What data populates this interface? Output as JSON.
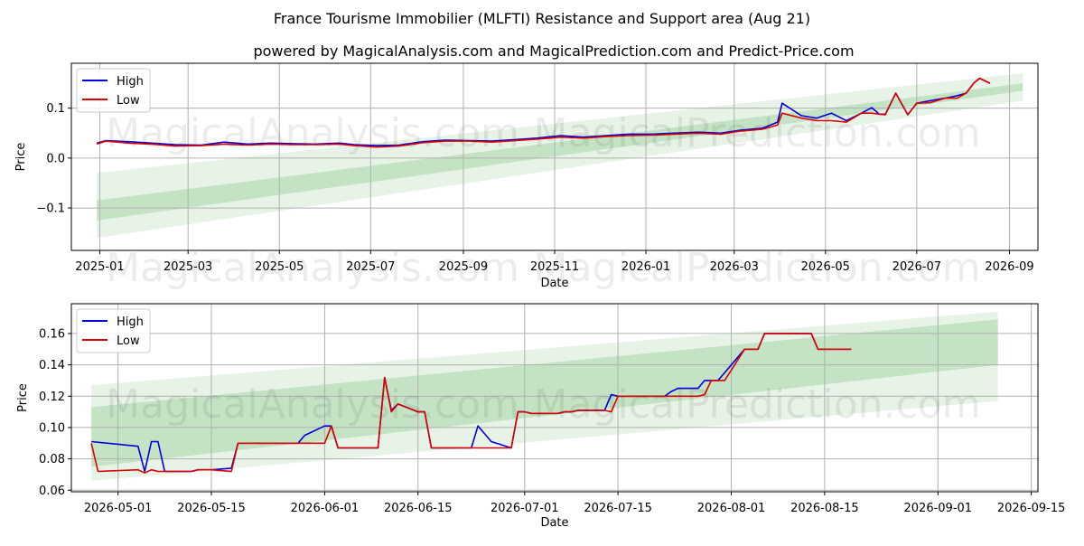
{
  "title": "France Tourisme Immobilier (MLFTI) Resistance and Support area (Aug 21)",
  "subtitle": "powered by MagicalAnalysis.com and MagicalPrediction.com and Predict-Price.com",
  "watermarks": [
    "MagicalAnalysis.com",
    "MagicalPrediction.com"
  ],
  "colors": {
    "high": "#0000dd",
    "low": "#dd0000",
    "band": "#2e9a2e",
    "grid": "#b0b0b0"
  },
  "chart_data": [
    {
      "type": "line",
      "xlabel": "Date",
      "ylabel": "Price",
      "xlim": [
        "2024-12-13",
        "2026-09-20"
      ],
      "ylim": [
        -0.185,
        0.19
      ],
      "xticks": [
        "2025-01-01",
        "2025-03-01",
        "2025-05-01",
        "2025-07-01",
        "2025-09-01",
        "2025-11-01",
        "2026-01-01",
        "2026-03-01",
        "2026-05-01",
        "2026-07-01",
        "2026-09-01"
      ],
      "xtick_labels": [
        "2025-01",
        "2025-03",
        "2025-05",
        "2025-07",
        "2025-09",
        "2025-11",
        "2026-01",
        "2026-03",
        "2026-05",
        "2026-07",
        "2026-09"
      ],
      "yticks": [
        -0.1,
        0.0,
        0.1
      ],
      "ytick_labels": [
        "−0.1",
        "0.0",
        "0.1"
      ],
      "grid": true,
      "legend": "top-left",
      "bands": [
        {
          "x": [
            "2024-12-30",
            "2026-09-10"
          ],
          "lower": [
            -0.16,
            0.115
          ],
          "upper": [
            -0.03,
            0.17
          ],
          "opacity": 0.12
        },
        {
          "x": [
            "2024-12-30",
            "2026-09-10"
          ],
          "lower": [
            -0.125,
            0.135
          ],
          "upper": [
            -0.085,
            0.15
          ],
          "opacity": 0.18
        }
      ],
      "series": [
        {
          "name": "High",
          "x": [
            "2024-12-30",
            "2025-01-05",
            "2025-01-20",
            "2025-02-05",
            "2025-02-20",
            "2025-03-10",
            "2025-03-25",
            "2025-04-10",
            "2025-04-25",
            "2025-05-10",
            "2025-05-25",
            "2025-06-10",
            "2025-06-20",
            "2025-07-05",
            "2025-07-20",
            "2025-08-05",
            "2025-08-20",
            "2025-09-05",
            "2025-09-20",
            "2025-10-05",
            "2025-10-20",
            "2025-11-05",
            "2025-11-20",
            "2025-12-05",
            "2025-12-20",
            "2026-01-05",
            "2026-01-20",
            "2026-02-05",
            "2026-02-20",
            "2026-03-05",
            "2026-03-20",
            "2026-03-30",
            "2026-04-02",
            "2026-04-15",
            "2026-04-25",
            "2026-05-05",
            "2026-05-15",
            "2026-05-25",
            "2026-06-01",
            "2026-06-06",
            "2026-06-10",
            "2026-06-17",
            "2026-06-25",
            "2026-07-01",
            "2026-07-10",
            "2026-07-20",
            "2026-07-28",
            "2026-08-03",
            "2026-08-08",
            "2026-08-12",
            "2026-08-19"
          ],
          "values": [
            0.03,
            0.035,
            0.033,
            0.03,
            0.027,
            0.026,
            0.032,
            0.028,
            0.03,
            0.029,
            0.028,
            0.03,
            0.027,
            0.025,
            0.026,
            0.033,
            0.036,
            0.035,
            0.034,
            0.037,
            0.04,
            0.045,
            0.042,
            0.045,
            0.048,
            0.048,
            0.05,
            0.052,
            0.05,
            0.056,
            0.06,
            0.072,
            0.11,
            0.085,
            0.08,
            0.09,
            0.075,
            0.09,
            0.101,
            0.088,
            0.088,
            0.13,
            0.087,
            0.11,
            0.115,
            0.12,
            0.125,
            0.13,
            0.15,
            0.16,
            0.15
          ]
        },
        {
          "name": "Low",
          "x": [
            "2024-12-30",
            "2025-01-05",
            "2025-01-20",
            "2025-02-05",
            "2025-02-20",
            "2025-03-10",
            "2025-03-25",
            "2025-04-10",
            "2025-04-25",
            "2025-05-10",
            "2025-05-25",
            "2025-06-10",
            "2025-06-20",
            "2025-07-05",
            "2025-07-20",
            "2025-08-05",
            "2025-08-20",
            "2025-09-05",
            "2025-09-20",
            "2025-10-05",
            "2025-10-20",
            "2025-11-05",
            "2025-11-20",
            "2025-12-05",
            "2025-12-20",
            "2026-01-05",
            "2026-01-20",
            "2026-02-05",
            "2026-02-20",
            "2026-03-05",
            "2026-03-20",
            "2026-03-30",
            "2026-04-02",
            "2026-04-15",
            "2026-04-25",
            "2026-05-05",
            "2026-05-15",
            "2026-05-25",
            "2026-06-01",
            "2026-06-06",
            "2026-06-10",
            "2026-06-17",
            "2026-06-25",
            "2026-07-01",
            "2026-07-10",
            "2026-07-20",
            "2026-07-28",
            "2026-08-03",
            "2026-08-08",
            "2026-08-12",
            "2026-08-19"
          ],
          "values": [
            0.028,
            0.034,
            0.03,
            0.028,
            0.024,
            0.025,
            0.028,
            0.026,
            0.028,
            0.027,
            0.027,
            0.028,
            0.025,
            0.022,
            0.024,
            0.031,
            0.034,
            0.034,
            0.032,
            0.035,
            0.038,
            0.042,
            0.04,
            0.043,
            0.045,
            0.046,
            0.048,
            0.05,
            0.048,
            0.054,
            0.058,
            0.066,
            0.09,
            0.08,
            0.075,
            0.075,
            0.072,
            0.09,
            0.09,
            0.088,
            0.087,
            0.13,
            0.087,
            0.11,
            0.111,
            0.12,
            0.12,
            0.13,
            0.15,
            0.16,
            0.15
          ]
        }
      ]
    },
    {
      "type": "line",
      "xlabel": "Date",
      "ylabel": "Price",
      "xlim": [
        "2026-04-24",
        "2026-09-16"
      ],
      "ylim": [
        0.059,
        0.179
      ],
      "xticks": [
        "2026-05-01",
        "2026-05-15",
        "2026-06-01",
        "2026-06-15",
        "2026-07-01",
        "2026-07-15",
        "2026-08-01",
        "2026-08-15",
        "2026-09-01",
        "2026-09-15"
      ],
      "xtick_labels": [
        "2026-05-01",
        "2026-05-15",
        "2026-06-01",
        "2026-06-15",
        "2026-07-01",
        "2026-07-15",
        "2026-08-01",
        "2026-08-15",
        "2026-09-01",
        "2026-09-15"
      ],
      "yticks": [
        0.06,
        0.08,
        0.1,
        0.12,
        0.14,
        0.16
      ],
      "ytick_labels": [
        "0.06",
        "0.08",
        "0.10",
        "0.12",
        "0.14",
        "0.16"
      ],
      "grid": true,
      "legend": "top-left",
      "bands": [
        {
          "x": [
            "2026-04-27",
            "2026-09-10"
          ],
          "lower": [
            0.066,
            0.117
          ],
          "upper": [
            0.127,
            0.174
          ],
          "opacity": 0.12
        },
        {
          "x": [
            "2026-04-27",
            "2026-09-10"
          ],
          "lower": [
            0.075,
            0.14
          ],
          "upper": [
            0.113,
            0.169
          ],
          "opacity": 0.18
        }
      ],
      "series": [
        {
          "name": "High",
          "x": [
            "2026-04-27",
            "2026-05-04",
            "2026-05-05",
            "2026-05-06",
            "2026-05-07",
            "2026-05-08",
            "2026-05-09",
            "2026-05-12",
            "2026-05-13",
            "2026-05-14",
            "2026-05-15",
            "2026-05-18",
            "2026-05-19",
            "2026-05-20",
            "2026-05-21",
            "2026-05-22",
            "2026-05-25",
            "2026-05-26",
            "2026-05-27",
            "2026-05-28",
            "2026-05-29",
            "2026-06-01",
            "2026-06-02",
            "2026-06-03",
            "2026-06-04",
            "2026-06-05",
            "2026-06-08",
            "2026-06-09",
            "2026-06-10",
            "2026-06-11",
            "2026-06-12",
            "2026-06-15",
            "2026-06-16",
            "2026-06-17",
            "2026-06-18",
            "2026-06-19",
            "2026-06-22",
            "2026-06-23",
            "2026-06-24",
            "2026-06-25",
            "2026-06-26",
            "2026-06-29",
            "2026-06-30",
            "2026-07-01",
            "2026-07-02",
            "2026-07-03",
            "2026-07-06",
            "2026-07-07",
            "2026-07-08",
            "2026-07-09",
            "2026-07-10",
            "2026-07-13",
            "2026-07-14",
            "2026-07-15",
            "2026-07-16",
            "2026-07-17",
            "2026-07-20",
            "2026-07-21",
            "2026-07-22",
            "2026-07-23",
            "2026-07-24",
            "2026-07-27",
            "2026-07-28",
            "2026-07-29",
            "2026-07-30",
            "2026-07-31",
            "2026-08-03",
            "2026-08-04",
            "2026-08-05",
            "2026-08-06",
            "2026-08-07",
            "2026-08-10",
            "2026-08-11",
            "2026-08-12",
            "2026-08-13",
            "2026-08-14",
            "2026-08-17",
            "2026-08-18",
            "2026-08-19"
          ],
          "values": [
            0.091,
            0.088,
            0.072,
            0.091,
            0.091,
            0.072,
            0.072,
            0.072,
            0.073,
            0.073,
            0.073,
            0.074,
            0.09,
            0.09,
            0.09,
            0.09,
            0.09,
            0.09,
            0.09,
            0.09,
            0.095,
            0.101,
            0.101,
            0.087,
            0.087,
            0.087,
            0.087,
            0.087,
            0.132,
            0.111,
            0.115,
            0.11,
            0.11,
            0.087,
            0.087,
            0.087,
            0.087,
            0.087,
            0.101,
            0.096,
            0.091,
            0.087,
            0.11,
            0.11,
            0.109,
            0.109,
            0.109,
            0.11,
            0.11,
            0.111,
            0.111,
            0.111,
            0.121,
            0.12,
            0.12,
            0.12,
            0.12,
            0.12,
            0.12,
            0.123,
            0.125,
            0.125,
            0.13,
            0.13,
            0.13,
            0.135,
            0.15,
            0.15,
            0.15,
            0.16,
            0.16,
            0.16,
            0.16,
            0.16,
            0.16,
            0.15,
            0.15,
            0.15,
            0.15
          ]
        },
        {
          "name": "Low",
          "x": [
            "2026-04-27",
            "2026-04-28",
            "2026-05-04",
            "2026-05-05",
            "2026-05-06",
            "2026-05-07",
            "2026-05-08",
            "2026-05-11",
            "2026-05-12",
            "2026-05-13",
            "2026-05-14",
            "2026-05-15",
            "2026-05-18",
            "2026-05-19",
            "2026-05-20",
            "2026-05-21",
            "2026-05-22",
            "2026-05-25",
            "2026-05-26",
            "2026-05-27",
            "2026-05-28",
            "2026-05-29",
            "2026-06-01",
            "2026-06-02",
            "2026-06-03",
            "2026-06-04",
            "2026-06-05",
            "2026-06-08",
            "2026-06-09",
            "2026-06-10",
            "2026-06-11",
            "2026-06-12",
            "2026-06-15",
            "2026-06-16",
            "2026-06-17",
            "2026-06-18",
            "2026-06-19",
            "2026-06-22",
            "2026-06-23",
            "2026-06-24",
            "2026-06-25",
            "2026-06-26",
            "2026-06-29",
            "2026-06-30",
            "2026-07-01",
            "2026-07-02",
            "2026-07-03",
            "2026-07-06",
            "2026-07-07",
            "2026-07-08",
            "2026-07-09",
            "2026-07-10",
            "2026-07-13",
            "2026-07-14",
            "2026-07-15",
            "2026-07-16",
            "2026-07-17",
            "2026-07-20",
            "2026-07-21",
            "2026-07-22",
            "2026-07-23",
            "2026-07-24",
            "2026-07-27",
            "2026-07-28",
            "2026-07-29",
            "2026-07-30",
            "2026-07-31",
            "2026-08-03",
            "2026-08-04",
            "2026-08-05",
            "2026-08-06",
            "2026-08-07",
            "2026-08-10",
            "2026-08-11",
            "2026-08-12",
            "2026-08-13",
            "2026-08-14",
            "2026-08-17",
            "2026-08-18",
            "2026-08-19"
          ],
          "values": [
            0.09,
            0.072,
            0.073,
            0.071,
            0.073,
            0.072,
            0.072,
            0.072,
            0.072,
            0.073,
            0.073,
            0.073,
            0.072,
            0.09,
            0.09,
            0.09,
            0.09,
            0.09,
            0.09,
            0.09,
            0.09,
            0.09,
            0.09,
            0.101,
            0.087,
            0.087,
            0.087,
            0.087,
            0.087,
            0.132,
            0.11,
            0.115,
            0.11,
            0.11,
            0.087,
            0.087,
            0.087,
            0.087,
            0.087,
            0.087,
            0.087,
            0.087,
            0.087,
            0.11,
            0.11,
            0.109,
            0.109,
            0.109,
            0.11,
            0.11,
            0.111,
            0.111,
            0.111,
            0.11,
            0.12,
            0.12,
            0.12,
            0.12,
            0.12,
            0.12,
            0.12,
            0.12,
            0.12,
            0.121,
            0.13,
            0.13,
            0.13,
            0.15,
            0.15,
            0.15,
            0.16,
            0.16,
            0.16,
            0.16,
            0.16,
            0.16,
            0.15,
            0.15,
            0.15,
            0.15
          ]
        }
      ]
    }
  ]
}
